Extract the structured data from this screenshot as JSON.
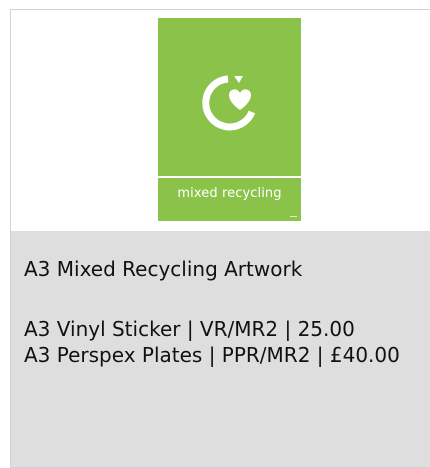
{
  "card": {
    "image_alt": "mixed recycling",
    "label": {
      "text": "mixed recycling",
      "background_color": "#8bc34a",
      "text_color": "#ffffff",
      "icon": "recycling-heart-icon"
    },
    "title": "A3 Mixed Recycling Artwork",
    "lines": [
      "A3 Vinyl Sticker | VR/MR2  | 25.00",
      "A3 Perspex Plates | PPR/MR2 | £40.00"
    ]
  },
  "colors": {
    "info_background": "#dedede",
    "border": "#cfd3d4",
    "text": "#111111"
  }
}
